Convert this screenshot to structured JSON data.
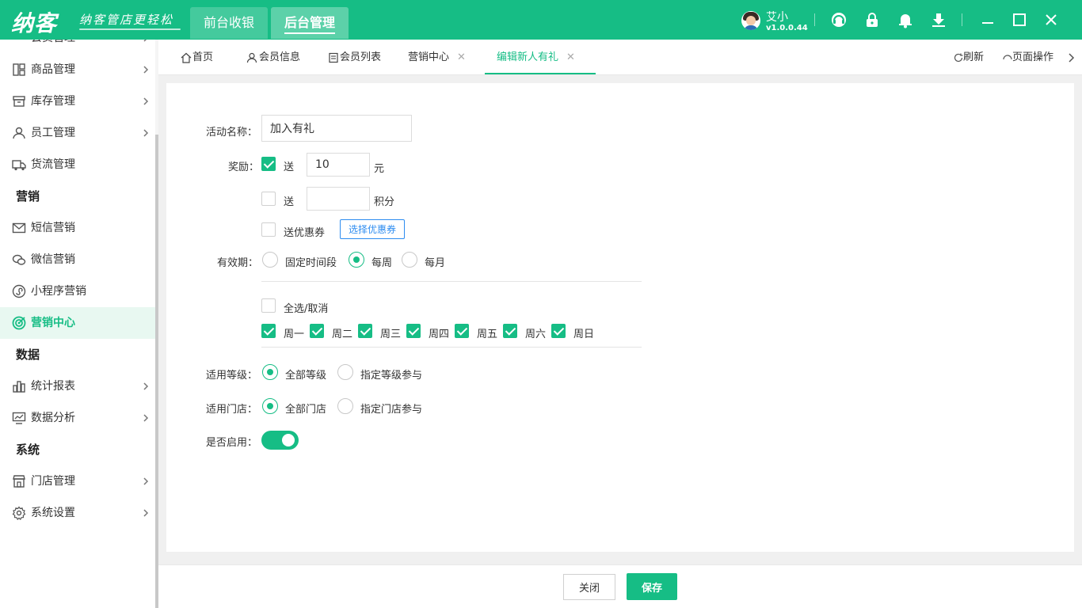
{
  "brand": {
    "logo": "纳客",
    "slogan": "纳客管店更轻松"
  },
  "top_tabs": [
    "前台收银",
    "后台管理"
  ],
  "user": {
    "name": "艾小",
    "version": "v1.0.0.44"
  },
  "top_icons": [
    "headset-icon",
    "lock-icon",
    "bell-icon",
    "download-icon",
    "minimize-icon",
    "maximize-icon",
    "close-icon"
  ],
  "sidebar": {
    "partial_item": "会员管理",
    "items_a": [
      "商品管理",
      "库存管理",
      "员工管理",
      "货流管理"
    ],
    "group_marketing": "营销",
    "items_b": [
      "短信营销",
      "微信营销",
      "小程序营销",
      "营销中心"
    ],
    "group_data": "数据",
    "items_c": [
      "统计报表",
      "数据分析"
    ],
    "group_system": "系统",
    "items_d": [
      "门店管理",
      "系统设置"
    ]
  },
  "tabs": [
    "首页",
    "会员信息",
    "会员列表",
    "营销中心",
    "编辑新人有礼"
  ],
  "tab_actions": {
    "refresh": "刷新",
    "page_ops": "页面操作"
  },
  "form": {
    "name_label": "活动名称：",
    "name_value": "加入有礼",
    "reward_label": "奖励：",
    "reward_send": "送",
    "reward_amount": "10",
    "reward_unit_money": "元",
    "reward_points_unit": "积分",
    "reward_coupon": "送优惠券",
    "choose_coupon": "选择优惠券",
    "validity_label": "有效期：",
    "validity_options": [
      "固定时间段",
      "每周",
      "每月"
    ],
    "select_all": "全选/取消",
    "weekdays": [
      "周一",
      "周二",
      "周三",
      "周四",
      "周五",
      "周六",
      "周日"
    ],
    "level_label": "适用等级：",
    "level_options": [
      "全部等级",
      "指定等级参与"
    ],
    "store_label": "适用门店：",
    "store_options": [
      "全部门店",
      "指定门店参与"
    ],
    "enabled_label": "是否启用："
  },
  "footer": {
    "close": "关闭",
    "save": "保存"
  },
  "colors": {
    "brand_green": "#16bd85",
    "link_blue": "#2d8cf0"
  }
}
